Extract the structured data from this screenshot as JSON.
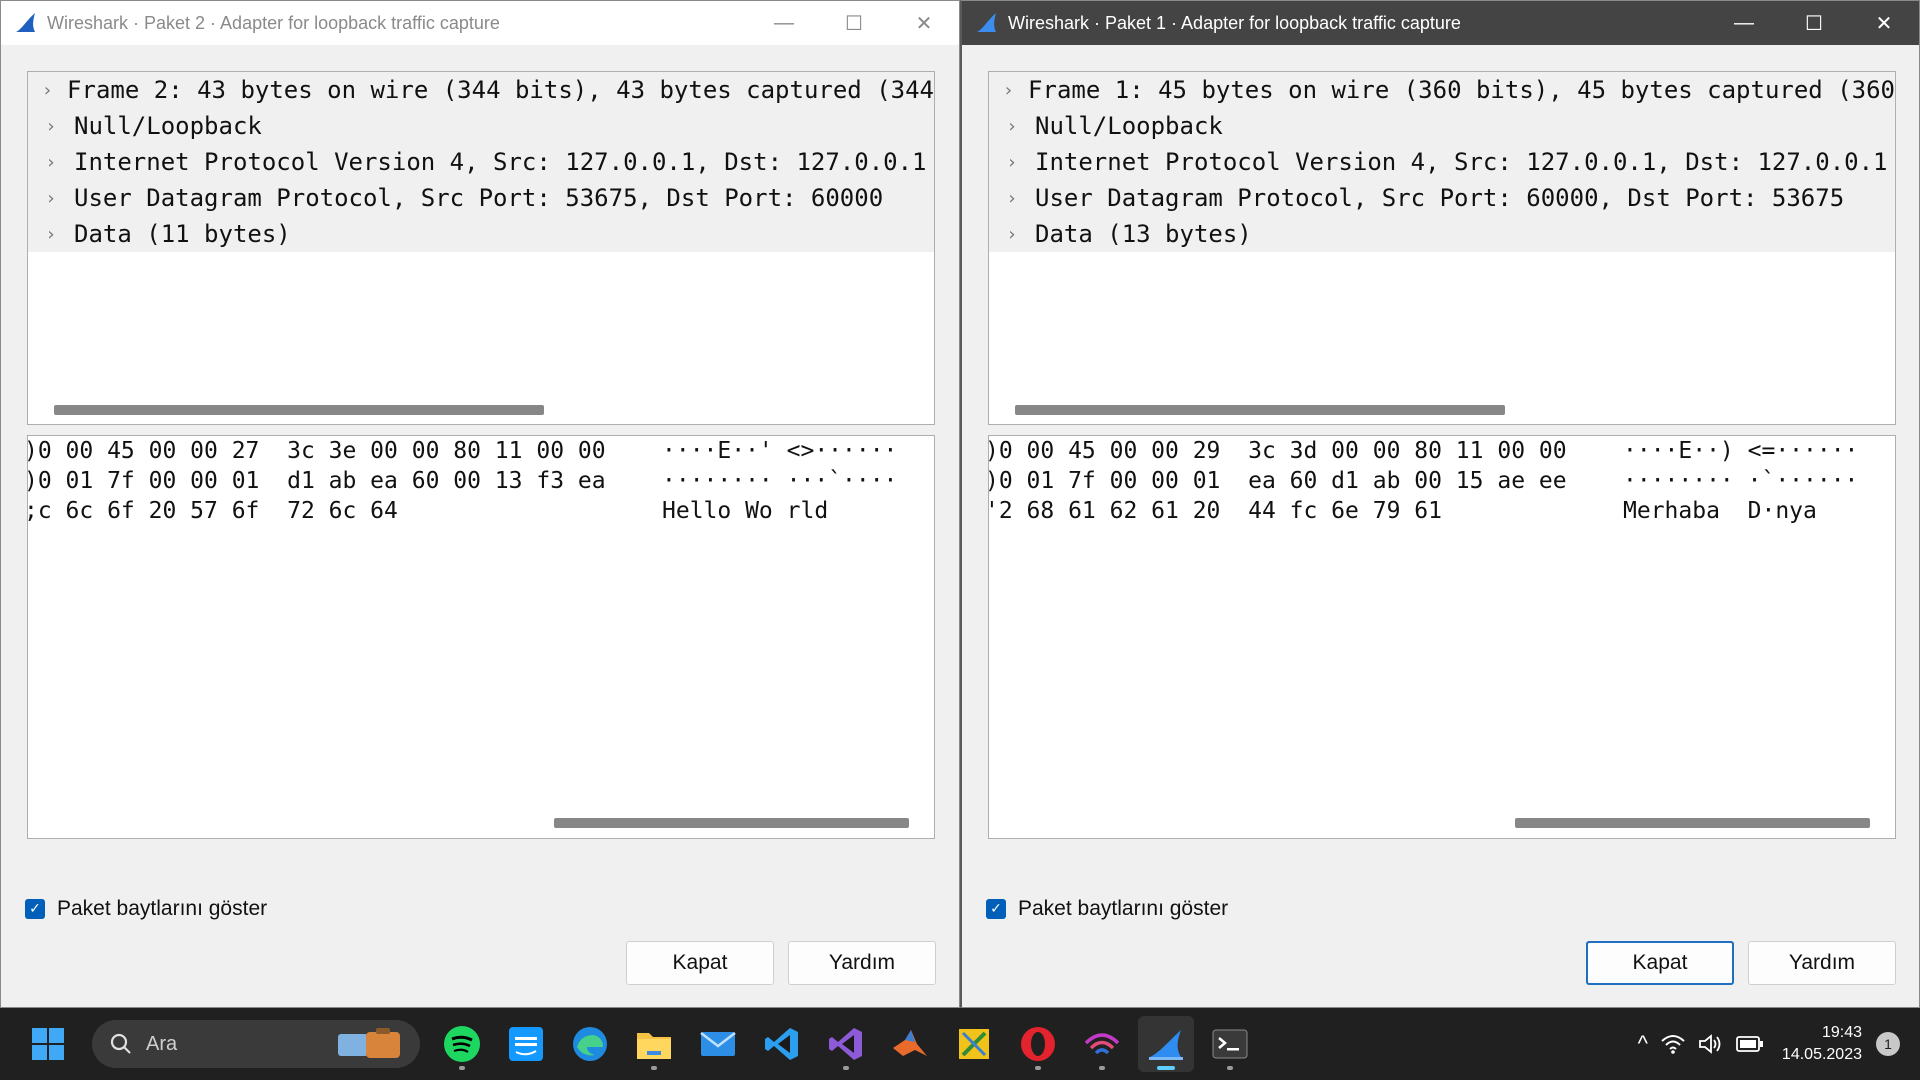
{
  "left_window": {
    "title": "Wireshark · Paket 2 · Adapter for loopback traffic capture",
    "tree": [
      "Frame 2: 43 bytes on wire (344 bits), 43 bytes captured (344",
      "Null/Loopback",
      "Internet Protocol Version 4, Src: 127.0.0.1, Dst: 127.0.0.1",
      "User Datagram Protocol, Src Port: 53675, Dst Port: 60000",
      "Data (11 bytes)"
    ],
    "hex": [
      ")0 00 45 00 00 27  3c 3e 00 00 80 11 00 00",
      ")0 01 7f 00 00 01  d1 ab ea 60 00 13 f3 ea",
      ";c 6c 6f 20 57 6f  72 6c 64"
    ],
    "ascii": [
      "····E··' <>······",
      "········ ···`····",
      "Hello Wo rld"
    ],
    "show_bytes_label": "Paket baytlarını göster",
    "close_label": "Kapat",
    "help_label": "Yardım"
  },
  "right_window": {
    "title": "Wireshark · Paket 1 · Adapter for loopback traffic capture",
    "tree": [
      "Frame 1: 45 bytes on wire (360 bits), 45 bytes captured (360",
      "Null/Loopback",
      "Internet Protocol Version 4, Src: 127.0.0.1, Dst: 127.0.0.1",
      "User Datagram Protocol, Src Port: 60000, Dst Port: 53675",
      "Data (13 bytes)"
    ],
    "hex": [
      ")0 00 45 00 00 29  3c 3d 00 00 80 11 00 00",
      ")0 01 7f 00 00 01  ea 60 d1 ab 00 15 ae ee",
      "'2 68 61 62 61 20  44 fc 6e 79 61"
    ],
    "ascii": [
      "····E··) <=······",
      "········ ·`······",
      "Merhaba  D·nya"
    ],
    "show_bytes_label": "Paket baytlarını göster",
    "close_label": "Kapat",
    "help_label": "Yardım"
  },
  "controls": {
    "minimize": "—",
    "maximize": "☐",
    "close": "✕",
    "chevron": "›",
    "check": "✓"
  },
  "taskbar": {
    "search_placeholder": "Ara",
    "time": "19:43",
    "date": "14.05.2023",
    "notification_count": "1",
    "tray_up": "^"
  },
  "colors": {
    "accent": "#005fb8",
    "taskbar_bg": "#202020",
    "active_title_bg": "#444444"
  }
}
